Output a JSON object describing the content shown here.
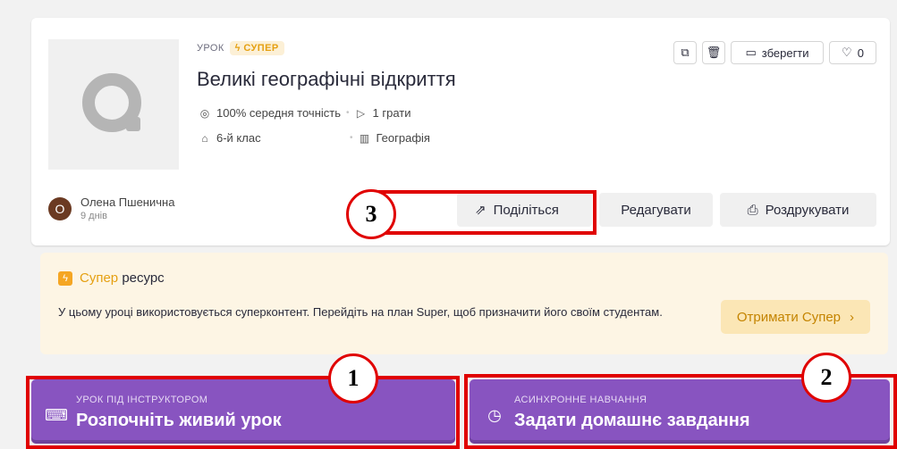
{
  "lesson": {
    "type_label": "УРОК",
    "super_badge": "СУПЕР",
    "title": "Великі географічні відкриття",
    "accuracy": "100% середня точність",
    "plays": "1 грати",
    "grade": "6-й клас",
    "subject": "Географія"
  },
  "top_actions": {
    "save_label": "зберегти",
    "like_count": "0"
  },
  "author": {
    "initial": "О",
    "name": "Олена Пшенична",
    "time": "9 днів"
  },
  "actions": {
    "share": "Поділіться",
    "edit": "Редагувати",
    "print": "Роздрукувати"
  },
  "super_panel": {
    "super_word": "Супер",
    "resource_word": "ресурс",
    "description": "У цьому уроці використовується суперконтент. Перейдіть на план Super, щоб призначити його своїм студентам.",
    "cta": "Отримати Супер"
  },
  "live_lesson": {
    "small_label": "УРОК ПІД ІНСТРУКТОРОМ",
    "label": "Розпочніть живий урок"
  },
  "homework": {
    "small_label": "АСИНХРОННЕ НАВЧАННЯ",
    "label": "Задати домашнє завдання"
  },
  "annotations": {
    "one": "1",
    "two": "2",
    "three": "3"
  },
  "colors": {
    "primary_purple": "#8854c0",
    "super_yellow": "#f5a623",
    "annotation_red": "#e00000"
  }
}
